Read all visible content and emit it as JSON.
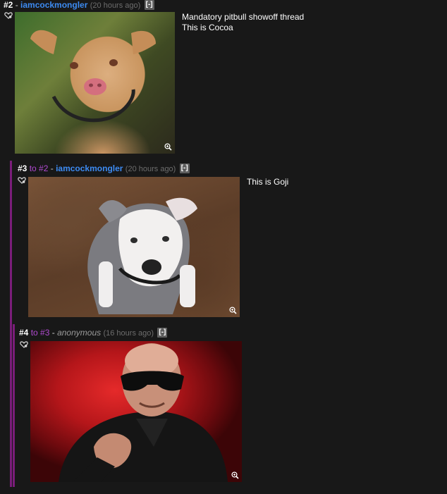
{
  "posts": [
    {
      "number": "#2",
      "dash": " - ",
      "username": "iamcockmongler",
      "time": "(20 hours ago)",
      "collapse": "[-]",
      "text_lines": [
        "Mandatory pitbull showoff thread",
        "This is Cocoa"
      ]
    },
    {
      "number": "#3",
      "to_word": " to ",
      "reply_to": "#2",
      "dash": " - ",
      "username": "iamcockmongler",
      "time": "(20 hours ago)",
      "collapse": "[-]",
      "text_lines": [
        "This is Goji"
      ]
    },
    {
      "number": "#4",
      "to_word": " to ",
      "reply_to": "#3",
      "dash": " - ",
      "username": "anonymous",
      "time": "(16 hours ago)",
      "collapse": "[-]",
      "text_lines": []
    }
  ],
  "colors": {
    "background": "#181818",
    "username": "#3d8bf2",
    "reply_link": "#b04ad0",
    "thread_line": "#7a1d7a"
  },
  "icons": [
    "heart-icon",
    "zoom-icon"
  ]
}
